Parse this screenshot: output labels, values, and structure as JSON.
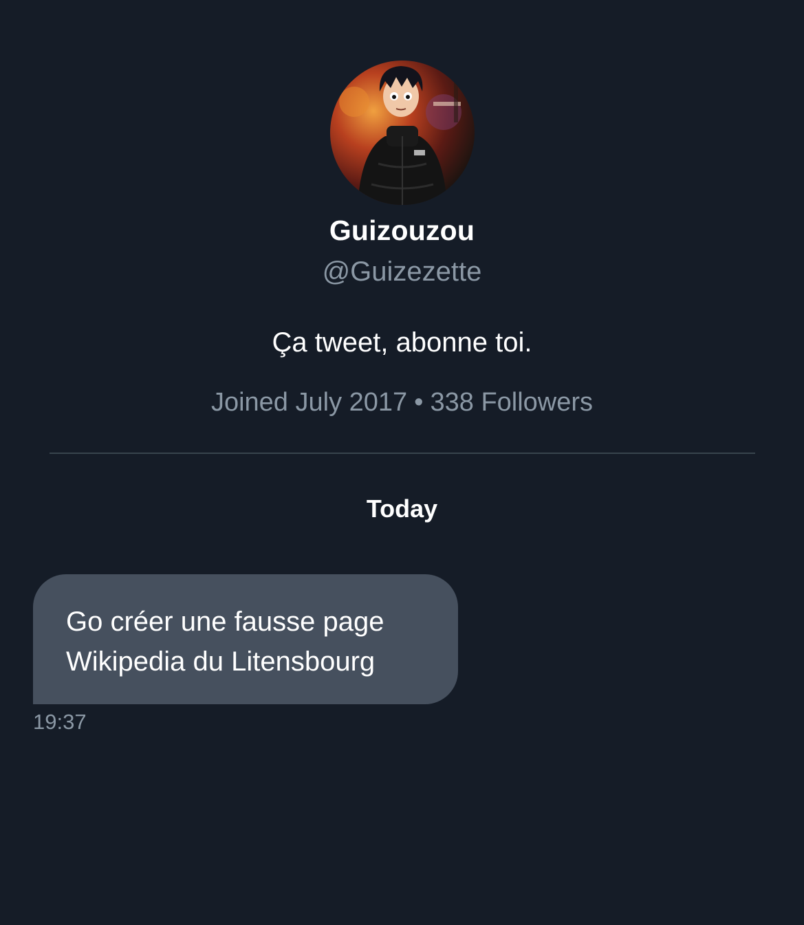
{
  "profile": {
    "display_name": "Guizouzou",
    "handle": "@Guizezette",
    "bio": "Ça tweet, abonne toi.",
    "joined": "Joined July 2017",
    "separator": "•",
    "followers": "338 Followers"
  },
  "conversation": {
    "date_separator": "Today",
    "messages": [
      {
        "lines": [
          "Go créer une fausse page",
          "Wikipedia du Litensbourg"
        ],
        "time": "19:37"
      }
    ]
  },
  "colors": {
    "background": "#151c27",
    "bubble": "#46505e",
    "muted_text": "#8b98a5",
    "divider": "#38444d"
  }
}
